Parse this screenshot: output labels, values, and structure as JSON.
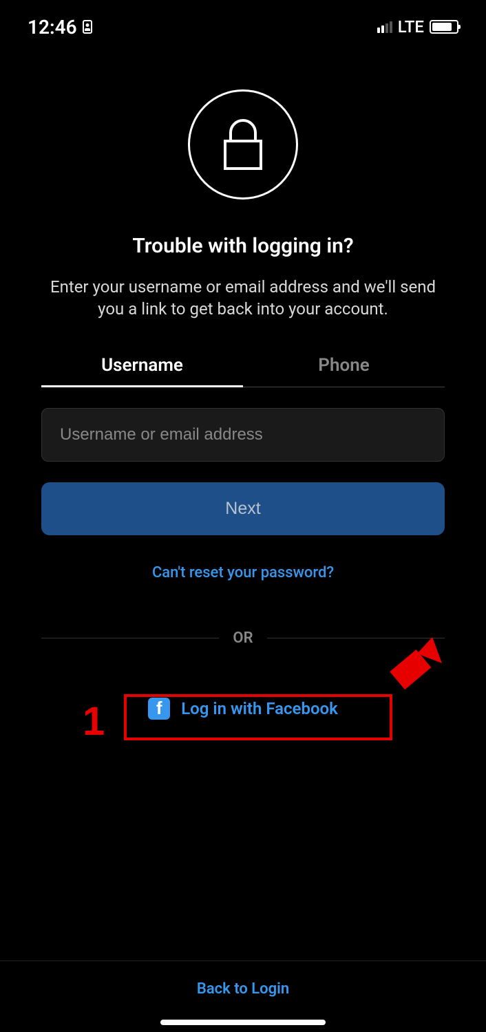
{
  "status_bar": {
    "time": "12:46",
    "network_label": "LTE"
  },
  "header": {
    "title": "Trouble with logging in?",
    "subtitle": "Enter your username or email address and we'll send you a link to get back into your account."
  },
  "tabs": {
    "username": "Username",
    "phone": "Phone"
  },
  "form": {
    "input_placeholder": "Username or email address",
    "next_button": "Next",
    "help_link": "Can't reset your password?"
  },
  "divider": {
    "or_text": "OR"
  },
  "facebook": {
    "label": "Log in with Facebook"
  },
  "footer": {
    "back_link": "Back to Login"
  },
  "annotation": {
    "number": "1"
  }
}
